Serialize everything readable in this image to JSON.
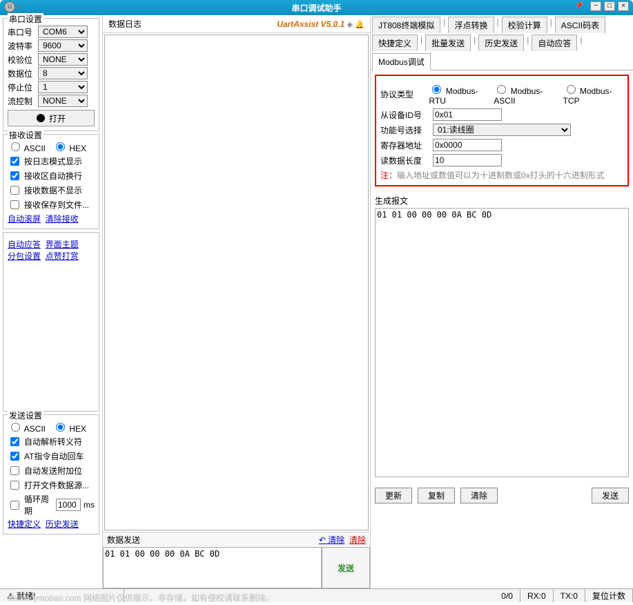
{
  "window": {
    "title": "串口调试助手"
  },
  "titlebar_buttons": {
    "min": "−",
    "max": "□",
    "close": "×"
  },
  "brand": {
    "name": "UartAssist V5.0.1"
  },
  "serial": {
    "legend": "串口设置",
    "port_label": "串口号",
    "port": "COM6",
    "baud_label": "波特率",
    "baud": "9600",
    "parity_label": "校验位",
    "parity": "NONE",
    "databits_label": "数据位",
    "databits": "8",
    "stopbits_label": "停止位",
    "stopbits": "1",
    "flow_label": "流控制",
    "flow": "NONE",
    "open_btn": "打开"
  },
  "recv": {
    "legend": "接收设置",
    "mode_ascii": "ASCII",
    "mode_hex": "HEX",
    "opt1": "按日志模式显示",
    "opt2": "接收区自动换行",
    "opt3": "接收数据不显示",
    "opt4": "接收保存到文件...",
    "link1": "自动滚屏",
    "link2": "清除接收"
  },
  "extra_links": {
    "a": "自动应答",
    "b": "界面主题",
    "c": "分包设置",
    "d": "点赞打赏"
  },
  "send": {
    "legend": "发送设置",
    "mode_ascii": "ASCII",
    "mode_hex": "HEX",
    "opt1": "自动解析转义符",
    "opt2": "AT指令自动回车",
    "opt3": "自动发送附加位",
    "opt4": "打开文件数据源...",
    "cycle_label": "循环周期",
    "cycle_value": "1000",
    "cycle_unit": "ms",
    "link1": "快捷定义",
    "link2": "历史发送"
  },
  "log_header": "数据日志",
  "data_send_header": "数据发送",
  "clear_top": "↶ 清除",
  "clear_btn": "清除",
  "send_area_value": "01 01 00 00 00 0A BC 0D",
  "big_send": "发送",
  "tabs": {
    "r1": [
      "JT808终端模拟",
      "浮点转换",
      "校验计算",
      "ASCII码表"
    ],
    "r2": [
      "快捷定义",
      "批量发送",
      "历史发送",
      "自动应答",
      "Modbus调试"
    ]
  },
  "proto": {
    "type_label": "协议类型",
    "rtu": "Modbus-RTU",
    "ascii": "Modbus-ASCII",
    "tcp": "Modbus-TCP",
    "slave_label": "从设备ID号",
    "slave": "0x01",
    "func_label": "功能号选择",
    "func": "01:读线圈",
    "addr_label": "寄存器地址",
    "addr": "0x0000",
    "len_label": "读数据长度",
    "len": "10",
    "note_prefix": "注：",
    "note": "输入地址或数值可以为十进制数或0x打头的十六进制形式"
  },
  "gen": {
    "header": "生成报文",
    "body": "01 01 00 00 00 0A BC 0D"
  },
  "buttons": {
    "update": "更新",
    "copy": "复制",
    "clear": "清除",
    "send": "发送"
  },
  "status": {
    "ready": "就绪!",
    "watermark": "www.toymoban.com  网络图片仅供展示，非存储，如有侵权请联系删除。",
    "frac": "0/0",
    "rx": "RX:0",
    "tx": "TX:0",
    "reset": "复位计数"
  }
}
